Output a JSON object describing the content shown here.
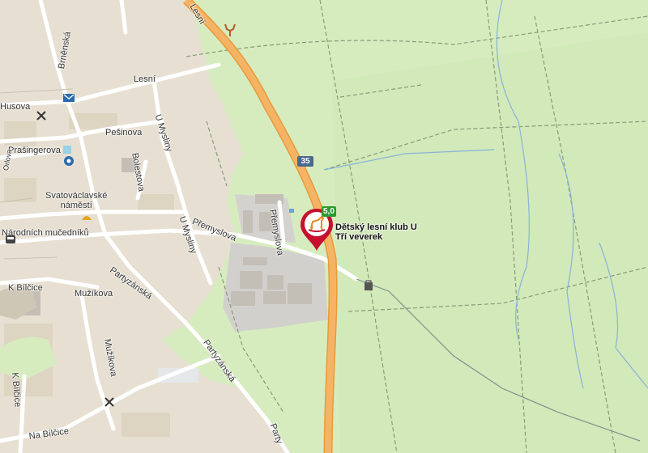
{
  "map": {
    "streets": {
      "lesni_top": "Lesní",
      "lesni": "Lesní",
      "husova": "Husova",
      "branska": "Brněnská",
      "pesinova": "Pešinova",
      "prasingerova": "Prašingerova",
      "orlova": "Orlova",
      "bolestova": "Bolestova",
      "u_mysliny_top": "U Mysliny",
      "u_mysliny": "U Mysliny",
      "premyslova_h": "Přemyslova",
      "premyslova_v": "Přemyslova",
      "narodnich": "Národních mučedníků",
      "k_bilcice": "K Bílčice",
      "muzikova_h": "Mužíkova",
      "muzikova_v": "Mužíkova",
      "partyzanska_1": "Partyzánská",
      "partyzanska_2": "Partyzánská",
      "partyzanska_3": "Party",
      "k_bilcice_2": "K Bílčice",
      "na_bilcice": "Na Bílčice"
    },
    "places": {
      "square": "Svatováclavské\nnáměstí"
    },
    "road_number": "35",
    "poi": {
      "name_line1": "Dětský lesní klub U",
      "name_line2": "Tří veverek",
      "rating": "5,0"
    },
    "icons": [
      "post-office-icon",
      "restaurant-icon",
      "museum-icon",
      "tram-icon",
      "pin-icon",
      "deer-icon",
      "mall-icon",
      "tools-icon"
    ]
  }
}
